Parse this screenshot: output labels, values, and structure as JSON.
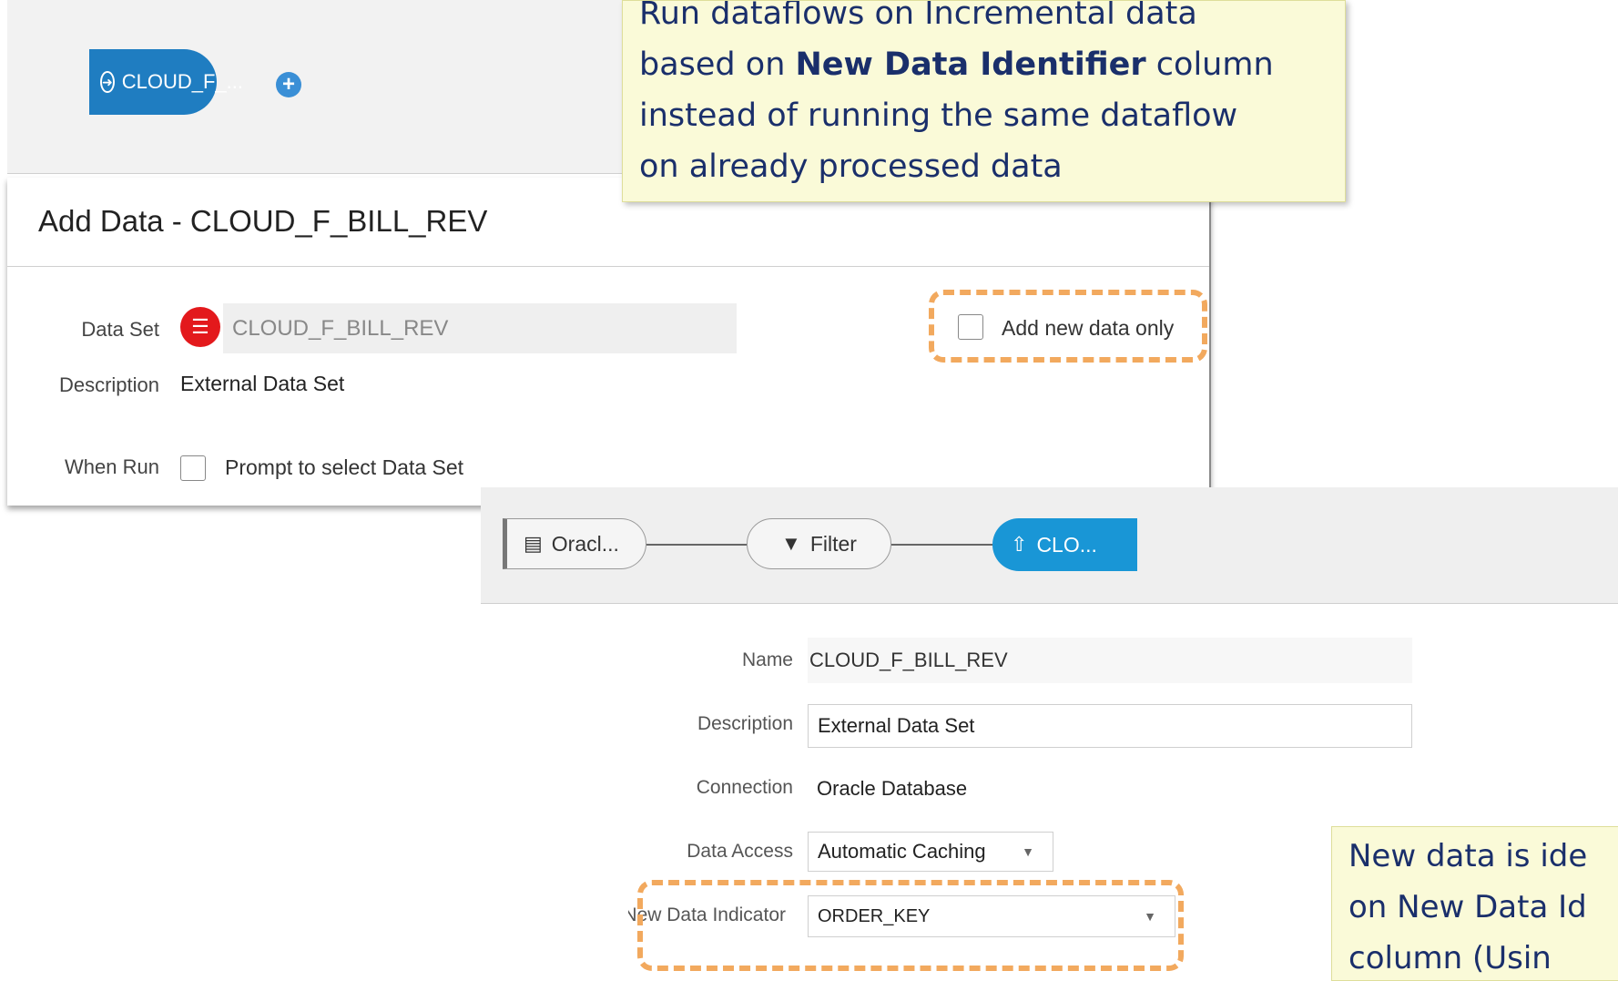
{
  "callouts": {
    "top": {
      "line1": "Run dataflows on Incremental data",
      "line2_pre": "based on ",
      "line2_bold": "New Data Identifier",
      "line2_post": " column",
      "line3": "instead of running the same dataflow",
      "line4": "on already processed data"
    },
    "bottom": {
      "line1": "New data is ide",
      "line2": "on New Data Id",
      "line3": "column (Usin"
    }
  },
  "source_node": {
    "label": "CLOUD_F_..."
  },
  "add_data_dialog": {
    "title": "Add Data - CLOUD_F_BILL_REV",
    "data_set_label": "Data Set",
    "data_set_value": "CLOUD_F_BILL_REV",
    "description_label": "Description",
    "description_value": "External Data Set",
    "when_run_label": "When Run",
    "prompt_label": "Prompt to select Data Set",
    "add_new_data_only_label": "Add new data only"
  },
  "flow": {
    "nodes": [
      {
        "label": "Oracl..."
      },
      {
        "label": "Filter"
      },
      {
        "label": "CLO..."
      }
    ]
  },
  "properties": {
    "name_label": "Name",
    "name_value": "CLOUD_F_BILL_REV",
    "description_label": "Description",
    "description_value": "External Data Set",
    "connection_label": "Connection",
    "connection_value": "Oracle Database",
    "data_access_label": "Data Access",
    "data_access_value": "Automatic Caching",
    "new_data_indicator_label": "New Data Indicator",
    "new_data_indicator_value": "ORDER_KEY"
  },
  "colors": {
    "accent_blue": "#1996d6",
    "node_blue": "#1f7dc1",
    "highlight_orange": "#f2a95e",
    "callout_bg": "#fafad8",
    "callout_text": "#1a2f6b",
    "dataset_red": "#e3191c"
  },
  "icons": {
    "source_node": "import-circle-icon",
    "add_node": "plus-circle-icon",
    "dataset": "database-icon",
    "filter": "filter-icon",
    "target": "upload-icon",
    "dropdown": "caret-down-icon"
  }
}
